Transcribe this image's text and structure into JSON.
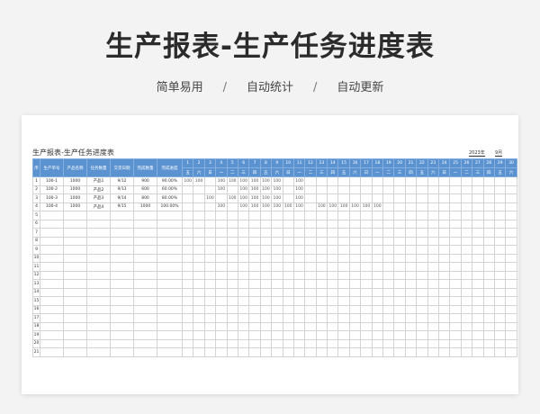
{
  "title": "生产报表-生产任务进度表",
  "features": [
    "简单易用",
    "自动统计",
    "自动更新"
  ],
  "feature_separator": "/",
  "sheet": {
    "title": "生产报表-生产任务进度表",
    "year": "2023年",
    "month": "9月",
    "columns": [
      "序",
      "生产单号",
      "产品名称",
      "任务数量",
      "交货日期",
      "完成数量",
      "完成进度"
    ],
    "days": [
      "1",
      "2",
      "3",
      "4",
      "5",
      "6",
      "7",
      "8",
      "9",
      "10",
      "11",
      "12",
      "13",
      "14",
      "15",
      "16",
      "17",
      "18",
      "19",
      "20",
      "21",
      "22",
      "23",
      "24",
      "25",
      "26",
      "27",
      "28",
      "29",
      "30"
    ],
    "weekdays": [
      "五",
      "六",
      "日",
      "一",
      "二",
      "三",
      "四",
      "五",
      "六",
      "日",
      "一",
      "二",
      "三",
      "四",
      "五",
      "六",
      "日",
      "一",
      "二",
      "三",
      "四",
      "五",
      "六",
      "日",
      "一",
      "二",
      "三",
      "四",
      "五",
      "六"
    ],
    "rows": [
      {
        "no": "1",
        "order": "100-1",
        "product": "1000",
        "name": "产品1",
        "date": "9/12",
        "done": "900",
        "progress": "90.00%",
        "daily": [
          "100",
          "100",
          "",
          "100",
          "100",
          "100",
          "100",
          "100",
          "100",
          "",
          "100",
          "",
          "",
          "",
          "",
          "",
          "",
          "",
          "",
          "",
          "",
          "",
          "",
          "",
          "",
          "",
          "",
          "",
          "",
          ""
        ]
      },
      {
        "no": "2",
        "order": "100-2",
        "product": "1000",
        "name": "产品2",
        "date": "9/13",
        "done": "600",
        "progress": "60.00%",
        "daily": [
          "",
          "",
          "",
          "100",
          "",
          "100",
          "100",
          "100",
          "100",
          "",
          "100",
          "",
          "",
          "",
          "",
          "",
          "",
          "",
          "",
          "",
          "",
          "",
          "",
          "",
          "",
          "",
          "",
          "",
          "",
          ""
        ]
      },
      {
        "no": "3",
        "order": "100-3",
        "product": "1000",
        "name": "产品3",
        "date": "9/14",
        "done": "800",
        "progress": "80.00%",
        "daily": [
          "",
          "",
          "100",
          "",
          "100",
          "100",
          "100",
          "100",
          "100",
          "",
          "100",
          "",
          "",
          "",
          "",
          "",
          "",
          "",
          "",
          "",
          "",
          "",
          "",
          "",
          "",
          "",
          "",
          "",
          "",
          ""
        ]
      },
      {
        "no": "4",
        "order": "100-4",
        "product": "1000",
        "name": "产品4",
        "date": "9/15",
        "done": "1000",
        "progress": "100.00%",
        "daily": [
          "",
          "",
          "",
          "100",
          "",
          "100",
          "100",
          "100",
          "100",
          "100",
          "100",
          "",
          "100",
          "100",
          "100",
          "100",
          "100",
          "100",
          "",
          "",
          "",
          "",
          "",
          "",
          "",
          "",
          "",
          "",
          "",
          ""
        ]
      }
    ],
    "empty_row_numbers": [
      "5",
      "6",
      "7",
      "8",
      "9",
      "10",
      "11",
      "12",
      "13",
      "14",
      "15",
      "16",
      "17",
      "18",
      "19",
      "20",
      "21"
    ]
  }
}
